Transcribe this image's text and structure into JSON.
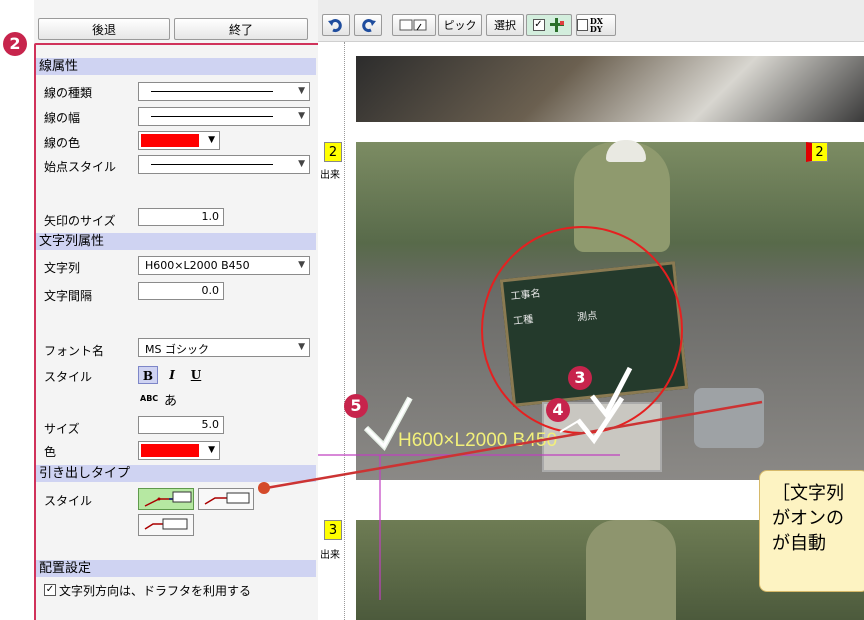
{
  "top_buttons": {
    "back": "後退",
    "end": "終了"
  },
  "callout_numbers": {
    "panel": "2",
    "mark3": "3",
    "mark4": "4",
    "mark5": "5"
  },
  "sections": {
    "line_attr": "線属性",
    "text_attr": "文字列属性",
    "leader_type": "引き出しタイプ",
    "layout": "配置設定"
  },
  "line_attr": {
    "type_label": "線の種類",
    "width_label": "線の幅",
    "color_label": "線の色",
    "start_style_label": "始点スタイル",
    "arrow_size_label": "矢印のサイズ",
    "arrow_size_value": "1.0",
    "line_color": "#ff0000"
  },
  "text_attr": {
    "string_label": "文字列",
    "string_value": "H600×L2000 B450",
    "spacing_label": "文字間隔",
    "spacing_value": "0.0",
    "font_label": "フォント名",
    "font_value": "MS ゴシック",
    "style_label": "スタイル",
    "bold": "B",
    "italic": "I",
    "underline": "U",
    "sample_small": "ABC",
    "sample_kana": "あ",
    "size_label": "サイズ",
    "size_value": "5.0",
    "color_label": "色",
    "text_color": "#ff0000"
  },
  "leader": {
    "style_label": "スタイル"
  },
  "layout": {
    "checkbox_label": "文字列方向は、ドラフタを利用する",
    "checked": true
  },
  "toolbar": {
    "undo_icon": "undo-icon",
    "redo_icon": "redo-icon",
    "pick": "ピック",
    "select": "選択",
    "dx_dy": "DX DY"
  },
  "viewer": {
    "tag2": "2",
    "tag3": "3",
    "annotation_text": "H600×L2000 B450",
    "side_label": "出来",
    "board_line1": "工事名",
    "board_line2": "工種",
    "board_line3": "測点"
  },
  "note_text": [
    "［文字列",
    "がオンの",
    "が自動"
  ],
  "colors": {
    "accent": "#c7244c",
    "section_bg": "#cfd3f2",
    "note_bg": "#fdf3c2"
  }
}
